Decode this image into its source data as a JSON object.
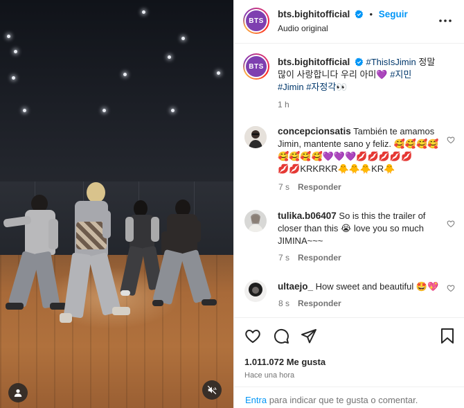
{
  "post": {
    "author": "bts.bighitofficial",
    "follow_label": "Seguir",
    "audio": "Audio original",
    "separator": "•",
    "avatar_text": "BTS"
  },
  "caption": {
    "username": "bts.bighitofficial",
    "hashtag1": "#ThisIsJimin",
    "text_line1": " 정말",
    "text_line2": "많이 사랑합니다 우리 아미💜 ",
    "hashtag2": "#지민",
    "hashtag3": "#Jimin",
    "hashtag4": " #자정각👀",
    "time": "1 h"
  },
  "comments": [
    {
      "username": "concepcionsatis",
      "line1": " También te amamos",
      "line2": "Jimin, mantente sano y feliz. 🥰🥰🥰🥰",
      "line3": "🥰🥰🥰🥰💜💜💜💋💋💋💋💋",
      "line4": "💋💋KRKRKR🐥🐥🐥KR🐥",
      "time": "7 s",
      "reply": "Responder"
    },
    {
      "username": "tulika.b06407",
      "line1": " So is this the trailer of",
      "line2": "closer than this 😭 love you so much",
      "line3": "JIMINA~~~",
      "time": "7 s",
      "reply": "Responder"
    },
    {
      "username": "ultaejo_",
      "line1": " How sweet and beautiful 🤩💖",
      "time": "8 s",
      "reply": "Responder"
    }
  ],
  "footer": {
    "likes": "1.011.072 Me gusta",
    "posted": "Hace una hora",
    "login_link": "Entra",
    "login_rest": " para indicar que te gusta o comentar."
  },
  "icons": {
    "more": "more-options-icon",
    "like": "heart-icon",
    "comment": "comment-icon",
    "share": "share-icon",
    "save": "bookmark-icon",
    "user": "user-tag-icon",
    "mute": "mute-icon",
    "verified": "verified-badge-icon"
  },
  "colors": {
    "accent": "#0095f6",
    "link": "#00376b",
    "secondary": "#737373",
    "brand": "#7e3fb0"
  }
}
